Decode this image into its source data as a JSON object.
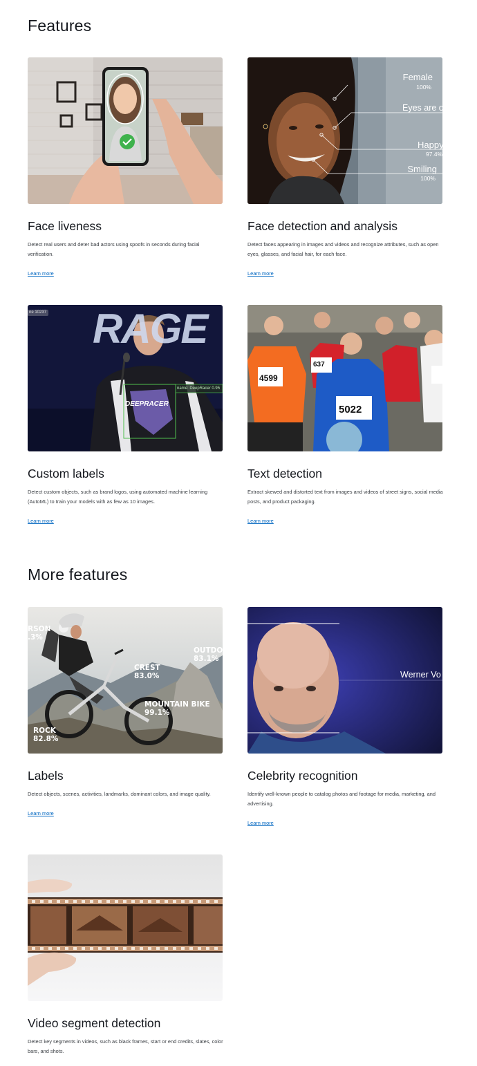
{
  "sections": {
    "features_title": "Features",
    "more_title": "More features"
  },
  "learn_more_label": "Learn more",
  "cards": {
    "face_liveness": {
      "title": "Face liveness",
      "desc": "Detect real users and deter bad actors using spoofs in seconds during facial verification."
    },
    "face_detection": {
      "title": "Face detection and analysis",
      "desc": "Detect faces appearing in images and videos and recognize attributes, such as open eyes, glasses, and facial hair, for each face.",
      "overlay": {
        "female": "Female",
        "female_pct": "100%",
        "eyes": "Eyes are o",
        "happy": "Happy",
        "happy_pct": "97.4%",
        "smiling": "Smiling",
        "smiling_pct": "100%"
      }
    },
    "custom_labels": {
      "title": "Custom labels",
      "desc": "Detect custom objects, such as brand logos, using automated machine learning (AutoML) to train your models with as few as 10 images.",
      "overlay": {
        "tag_left": "ne 10237",
        "tag_right": "name: DeepRacer 0.95",
        "backdrop": "RAGE",
        "logo": "DEEPRACER"
      }
    },
    "text_detection": {
      "title": "Text detection",
      "desc": "Extract skewed and distorted text from images and videos of street signs, social media posts, and product packaging.",
      "overlay": {
        "bib1": "4599",
        "bib2": "637",
        "bib3": "5022"
      }
    },
    "labels": {
      "title": "Labels",
      "desc": "Detect objects, scenes, activities, landmarks, dominant colors, and image quality.",
      "overlay": {
        "person": "RSON",
        "person_pct": ".3%",
        "outdoor": "OUTDO",
        "outdoor_pct": "83.1%",
        "crest": "CREST",
        "crest_pct": "83.0%",
        "bike": "MOUNTAIN BIKE",
        "bike_pct": "99.1%",
        "rock": "ROCK",
        "rock_pct": "82.8%"
      }
    },
    "celebrity": {
      "title": "Celebrity recognition",
      "desc": "Identify well-known people to catalog photos and footage for media, marketing, and advertising.",
      "overlay": {
        "name": "Werner Vo"
      }
    },
    "video_segment": {
      "title": "Video segment detection",
      "desc": "Detect key segments in videos, such as black frames, start or end credits, slates, color bars, and shots."
    }
  }
}
